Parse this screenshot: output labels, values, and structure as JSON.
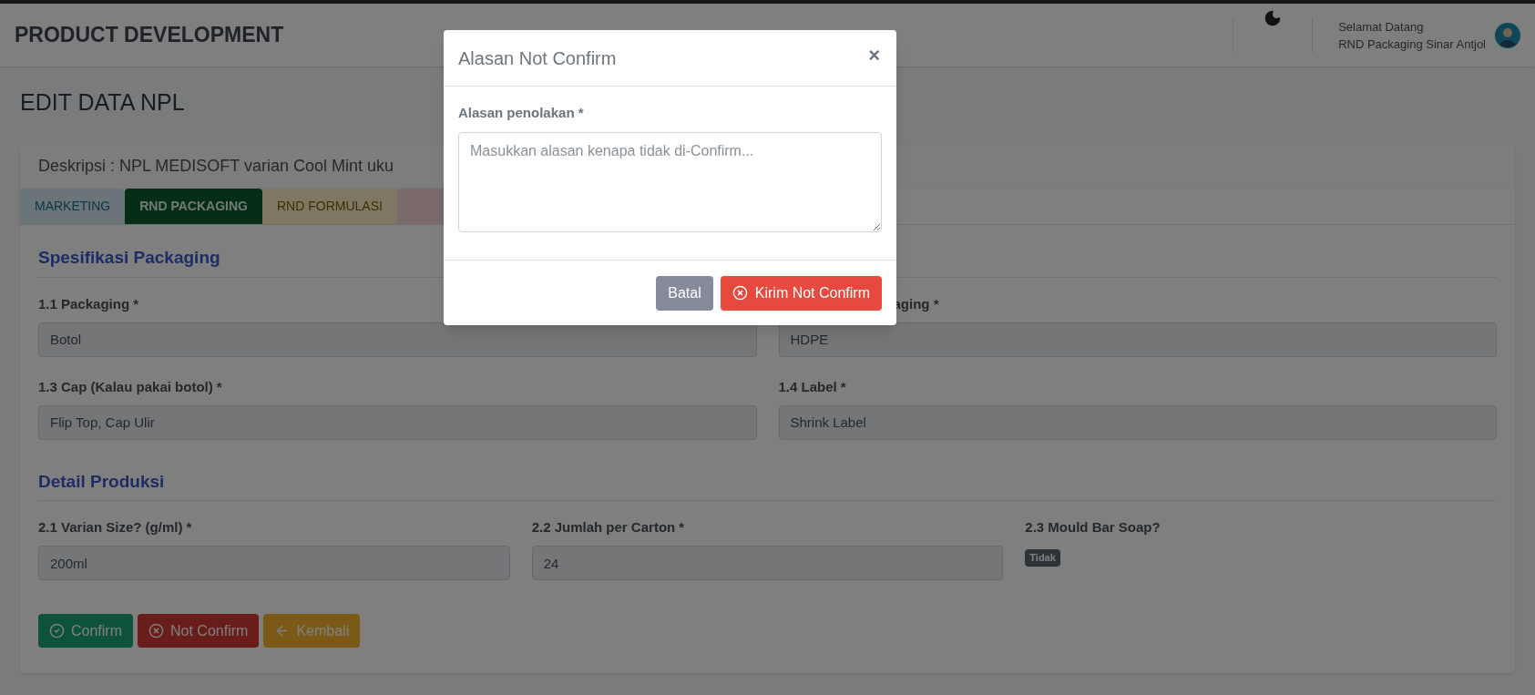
{
  "header": {
    "title": "PRODUCT DEVELOPMENT",
    "greeting": "Selamat Datang",
    "user": "RND Packaging Sinar Antjol"
  },
  "page_title": "EDIT DATA NPL",
  "description": "Deskripsi : NPL MEDISOFT varian Cool Mint uku",
  "tabs": [
    {
      "label": "MARKETING",
      "selected": false
    },
    {
      "label": "RND PACKAGING",
      "selected": true
    },
    {
      "label": "RND FORMULASI",
      "selected": false
    },
    {
      "selected": false
    }
  ],
  "sections": [
    {
      "title": "Spesifikasi Packaging",
      "fields": [
        {
          "kind": "input",
          "label": "1.1 Packaging *",
          "value": "Botol"
        },
        {
          "kind": "input",
          "label": "aging *",
          "value": "HDPE"
        },
        {
          "kind": "input",
          "label": "1.3 Cap (Kalau pakai botol) *",
          "value": "Flip Top, Cap Ulir"
        },
        {
          "kind": "input",
          "label": "1.4 Label *",
          "value": "Shrink Label"
        }
      ]
    },
    {
      "title": "Detail Produksi",
      "fields": [
        {
          "kind": "input",
          "label": "2.1 Varian Size? (g/ml) *",
          "value": "200ml"
        },
        {
          "kind": "input",
          "label": "2.2 Jumlah per Carton *",
          "value": "24"
        },
        {
          "kind": "badge",
          "label": "2.3 Mould Bar Soap?",
          "value": "Tidak"
        }
      ]
    }
  ],
  "actions": [
    {
      "kind": "confirm",
      "label": "Confirm"
    },
    {
      "kind": "reject",
      "label": "Not Confirm"
    },
    {
      "kind": "back",
      "label": "Kembali"
    }
  ],
  "modal": {
    "title": "Alasan Not Confirm",
    "close": "×",
    "field_label": "Alasan penolakan *",
    "placeholder": "Masukkan alasan kenapa tidak di-Confirm...",
    "buttons": [
      {
        "kind": "cancel",
        "label": "Batal"
      },
      {
        "kind": "submit",
        "label": "Kirim Not Confirm"
      }
    ]
  }
}
